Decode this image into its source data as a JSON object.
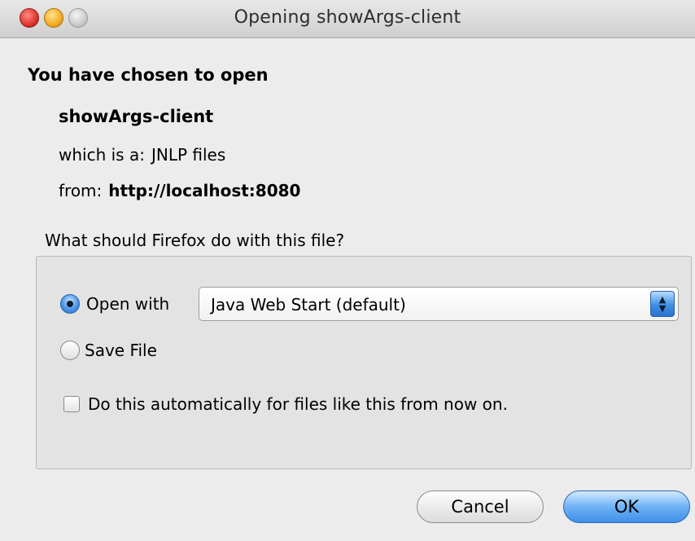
{
  "window": {
    "title": "Opening showArgs-client"
  },
  "dialog": {
    "heading": "You have chosen to open",
    "filename": "showArgs-client",
    "type_label": "which is a:",
    "type_value": "JNLP files",
    "from_label": "from:",
    "from_value": "http://localhost:8080",
    "question": "What should Firefox do with this file?"
  },
  "options": {
    "open_with_label": "Open with",
    "open_with_selected": true,
    "application": "Java Web Start (default)",
    "save_file_label": "Save File",
    "save_file_selected": false,
    "auto_label": "Do this automatically for files like this from now on.",
    "auto_checked": false
  },
  "buttons": {
    "cancel": "Cancel",
    "ok": "OK"
  },
  "icons": {
    "close": "close-icon",
    "minimize": "minimize-icon",
    "zoom": "zoom-icon",
    "select_arrows": "up-down-arrows-icon"
  }
}
